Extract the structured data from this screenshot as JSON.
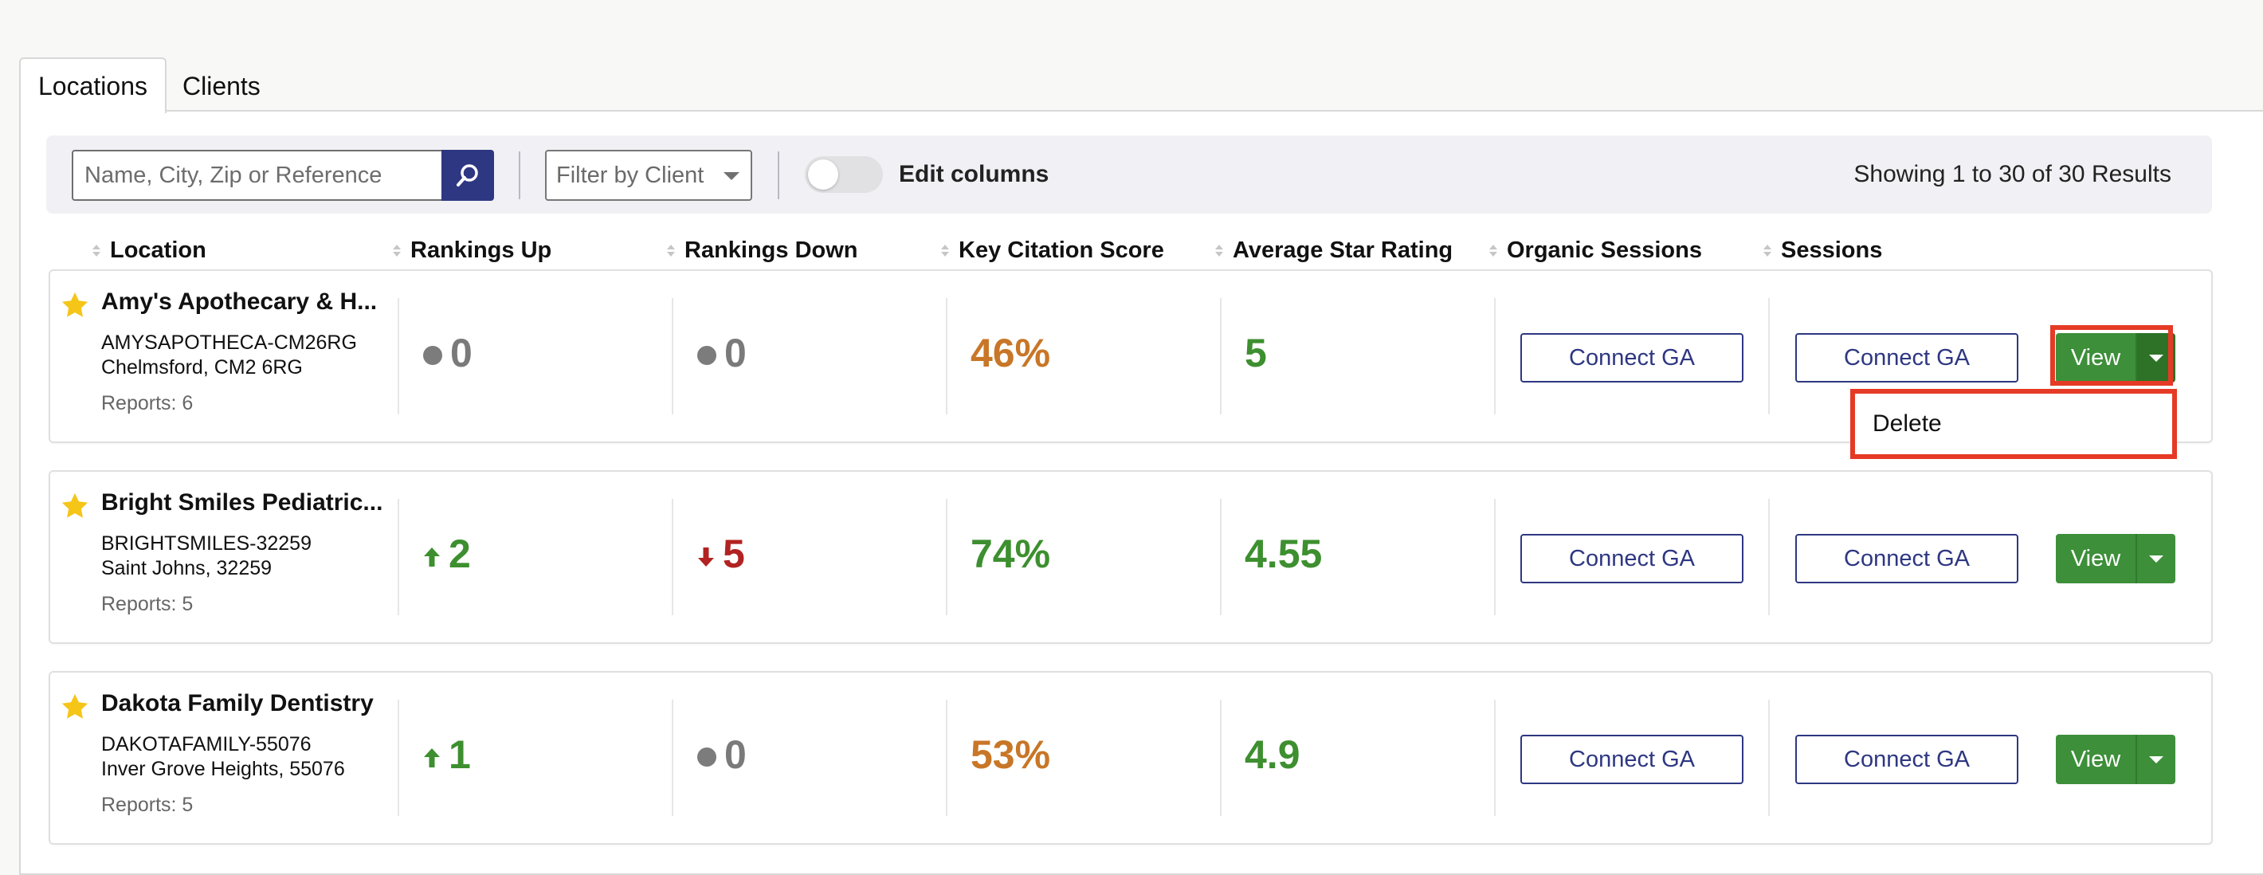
{
  "tabs": [
    {
      "label": "Locations",
      "active": true
    },
    {
      "label": "Clients",
      "active": false
    }
  ],
  "toolbar": {
    "search_placeholder": "Name, City, Zip or Reference",
    "filter_placeholder": "Filter by Client",
    "edit_columns_label": "Edit columns",
    "edit_columns_on": false,
    "results_text": "Showing 1 to 30 of 30 Results"
  },
  "columns": [
    "Location",
    "Rankings Up",
    "Rankings Down",
    "Key Citation Score",
    "Average Star Rating",
    "Organic Sessions",
    "Sessions"
  ],
  "rows": [
    {
      "name": "Amy's Apothecary & H...",
      "reference": "AMYSAPOTHECA-CM26RG",
      "city": "Chelmsford, CM2 6RG",
      "reports": "Reports: 6",
      "rankings_up": {
        "value": "0",
        "trend": "none"
      },
      "rankings_down": {
        "value": "0",
        "trend": "none"
      },
      "citation_score": "46%",
      "star_rating": "5",
      "organic_sessions_btn": "Connect GA",
      "sessions_btn": "Connect GA",
      "view_label": "View"
    },
    {
      "name": "Bright Smiles Pediatric...",
      "reference": "BRIGHTSMILES-32259",
      "city": "Saint Johns, 32259",
      "reports": "Reports: 5",
      "rankings_up": {
        "value": "2",
        "trend": "up"
      },
      "rankings_down": {
        "value": "5",
        "trend": "down"
      },
      "citation_score": "74%",
      "star_rating": "4.55",
      "organic_sessions_btn": "Connect GA",
      "sessions_btn": "Connect GA",
      "view_label": "View"
    },
    {
      "name": "Dakota Family Dentistry",
      "reference": "DAKOTAFAMILY-55076",
      "city": "Inver Grove Heights, 55076",
      "reports": "Reports: 5",
      "rankings_up": {
        "value": "1",
        "trend": "up"
      },
      "rankings_down": {
        "value": "0",
        "trend": "none"
      },
      "citation_score": "53%",
      "star_rating": "4.9",
      "organic_sessions_btn": "Connect GA",
      "sessions_btn": "Connect GA",
      "view_label": "View"
    }
  ],
  "dropdown_menu": {
    "items": [
      "Delete"
    ]
  },
  "colors": {
    "primary": "#2e3782",
    "view_green": "#3d8f3a",
    "positive": "#3d8f2f",
    "negative": "#b22222",
    "warning": "#c87627",
    "neutral": "#7a7a7a",
    "highlight": "#e53a25",
    "star": "#f5c518"
  }
}
